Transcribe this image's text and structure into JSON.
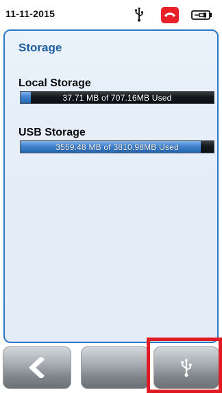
{
  "status_bar": {
    "date": "11-11-2015",
    "icons": [
      "usb-icon",
      "phone-hangup-icon",
      "battery-icon"
    ],
    "phone_color": "#e8202a"
  },
  "panel": {
    "title": "Storage",
    "local": {
      "label": "Local Storage",
      "usage_text": "37.71 MB of 707.16MB Used",
      "used_fraction": 0.053
    },
    "usb": {
      "label": "USB Storage",
      "usage_text": "3559.48 MB of 3810.98MB Used",
      "used_fraction": 0.934
    }
  },
  "buttons": [
    {
      "name": "back-button",
      "icon": "chevron-left-icon"
    },
    {
      "name": "blank-button",
      "icon": ""
    },
    {
      "name": "usb-button",
      "icon": "usb-icon",
      "highlighted": true
    }
  ],
  "colors": {
    "accent": "#2b78c9",
    "highlight": "#e01a22",
    "bar_fill": "#3f83cf"
  }
}
